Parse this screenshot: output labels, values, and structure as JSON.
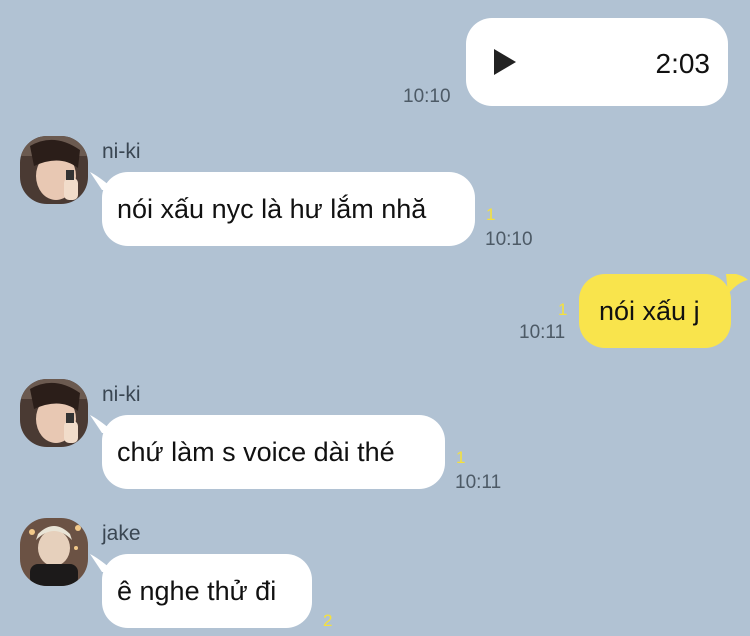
{
  "theme": {
    "background": "#b1c2d3",
    "my_bubble": "#f9e44c",
    "their_bubble": "#ffffff",
    "unread_color": "#f6e13a"
  },
  "messages": [
    {
      "sender": "me",
      "type": "voice",
      "duration": "2:03",
      "time": "10:10",
      "icon": "play-icon"
    },
    {
      "sender": "ni-ki",
      "type": "text",
      "text": "nói xấu nyc là hư lắm nhă",
      "unread": "1",
      "time": "10:10"
    },
    {
      "sender": "me",
      "type": "text",
      "text": "nói xấu j",
      "unread": "1",
      "time": "10:11"
    },
    {
      "sender": "ni-ki",
      "type": "text",
      "text": "chứ làm s voice dài thé",
      "unread": "1",
      "time": "10:11"
    },
    {
      "sender": "jake",
      "type": "text",
      "text": "ê nghe thử đi",
      "unread": "2"
    }
  ]
}
